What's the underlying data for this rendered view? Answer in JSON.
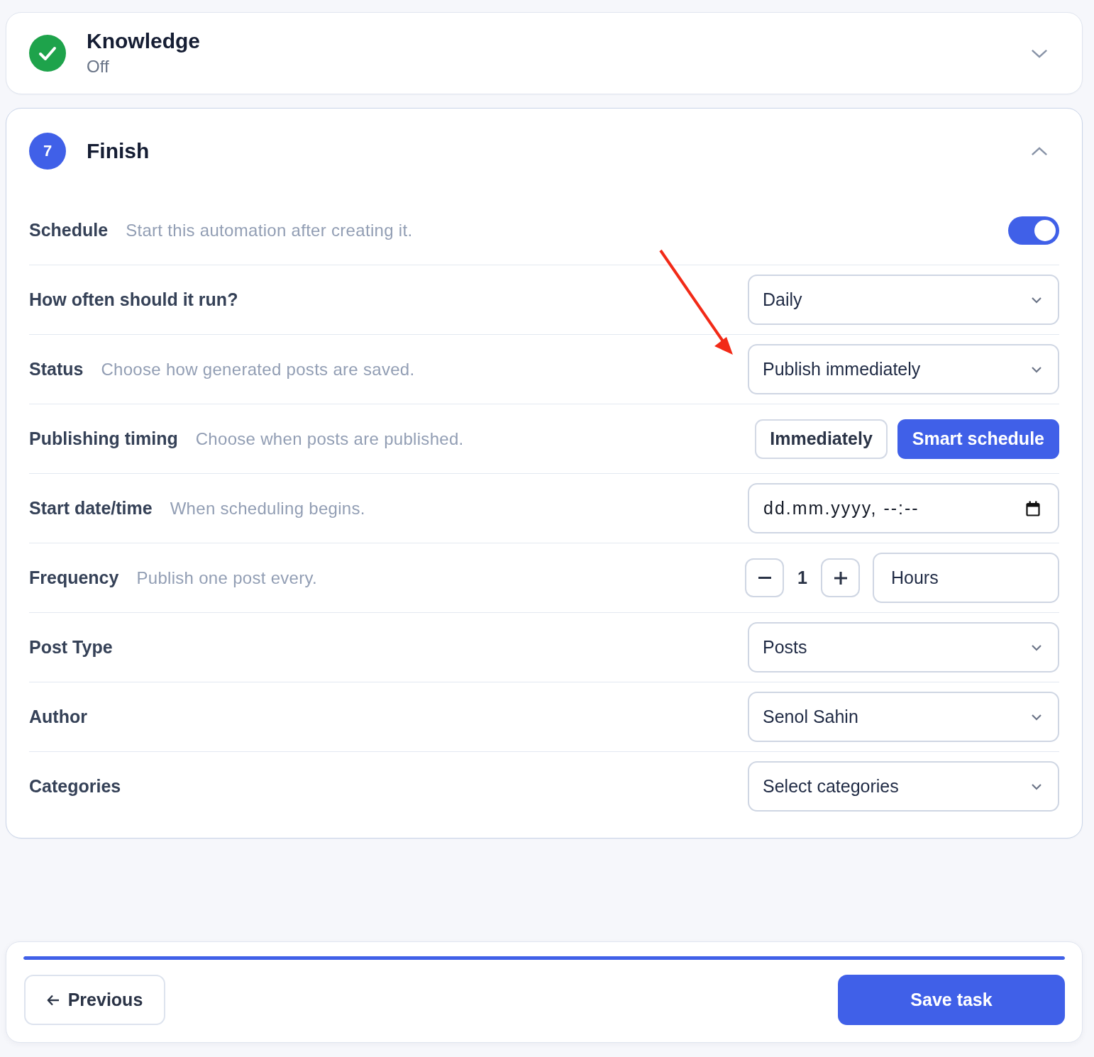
{
  "sections": [
    {
      "kind": "completed",
      "title": "Knowledge",
      "subtitle": "Off",
      "expanded": false
    },
    {
      "kind": "active",
      "number": "7",
      "title": "Finish",
      "expanded": true,
      "rows": [
        {
          "kind": "toggle",
          "label": "Schedule",
          "description": "Start this automation after creating it.",
          "on": true
        },
        {
          "kind": "select",
          "label": "How often should it run?",
          "value": "Daily"
        },
        {
          "kind": "select",
          "label": "Status",
          "description": "Choose how generated posts are saved.",
          "value": "Publish immediately"
        },
        {
          "kind": "choice",
          "label": "Publishing timing",
          "description": "Choose when posts are published.",
          "options": [
            {
              "label": "Immediately",
              "selected": false
            },
            {
              "label": "Smart schedule",
              "selected": true
            }
          ]
        },
        {
          "kind": "datetime",
          "label": "Start date/time",
          "description": "When scheduling begins.",
          "placeholder": "dd.mm.yyyy, --:--"
        },
        {
          "kind": "stepper",
          "label": "Frequency",
          "description": "Publish one post every.",
          "count": "1",
          "unit": "Hours"
        },
        {
          "kind": "select",
          "label": "Post Type",
          "value": "Posts"
        },
        {
          "kind": "select",
          "label": "Author",
          "value": "Senol Sahin"
        },
        {
          "kind": "select",
          "label": "Categories",
          "value": "Select categories"
        }
      ]
    }
  ],
  "footer": {
    "progress": {
      "level": 1
    },
    "previous_button": "Previous",
    "save_button": "Save task"
  }
}
